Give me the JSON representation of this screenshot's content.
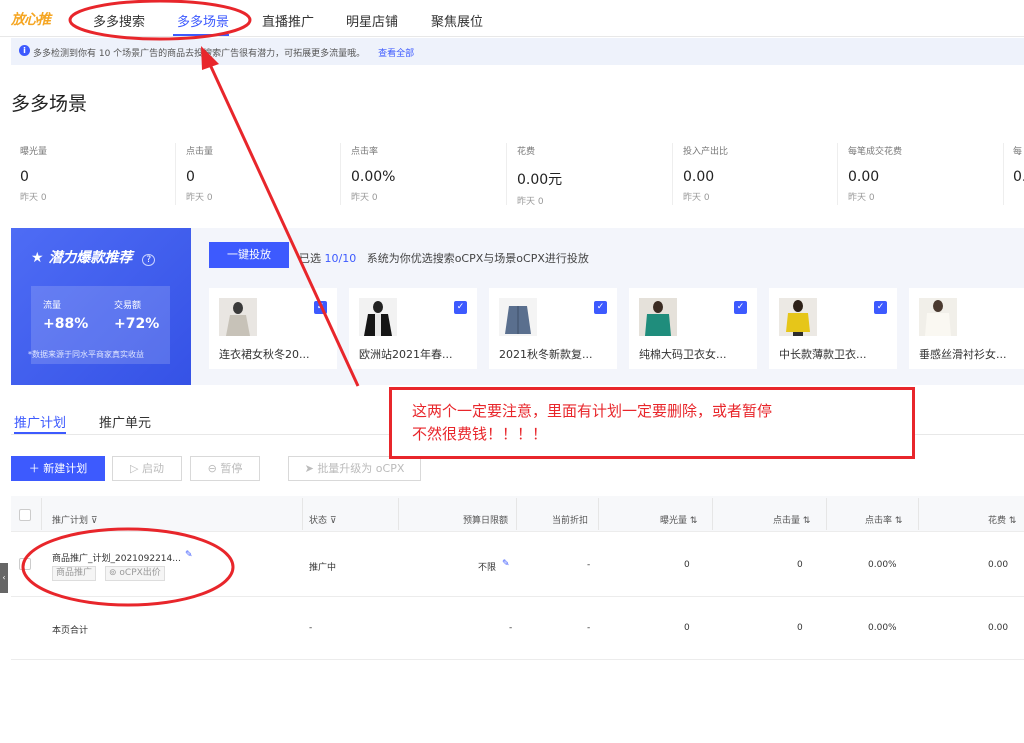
{
  "nav": {
    "logo": "放心推",
    "tabs": [
      {
        "label": "多多搜索"
      },
      {
        "label": "多多场景"
      },
      {
        "label": "直播推广"
      },
      {
        "label": "明星店铺"
      },
      {
        "label": "聚焦展位"
      }
    ],
    "active_index": 1
  },
  "notice": {
    "text": "多多检测到你有 10 个场景广告的商品去投搜索广告很有潜力，可拓展更多流量哦。",
    "link": "查看全部"
  },
  "page_title": "多多场景",
  "metrics": [
    {
      "label": "曝光量",
      "value": "0",
      "sub": "昨天 0"
    },
    {
      "label": "点击量",
      "value": "0",
      "sub": "昨天 0"
    },
    {
      "label": "点击率",
      "value": "0.00%",
      "sub": "昨天 0"
    },
    {
      "label": "花费",
      "value": "0.00元",
      "sub": "昨天 0"
    },
    {
      "label": "投入产出比",
      "value": "0.00",
      "sub": "昨天 0"
    },
    {
      "label": "每笔成交花费",
      "value": "0.00",
      "sub": "昨天 0"
    },
    {
      "label": "每",
      "value": "0.",
      "sub": ""
    }
  ],
  "recommend": {
    "title": "潜力爆款推荐",
    "help": "?",
    "stats": [
      {
        "label": "流量",
        "value": "+88%"
      },
      {
        "label": "交易额",
        "value": "+72%"
      }
    ],
    "note": "*数据来源于同水平商家真实收益",
    "launch_button": "一键投放",
    "selected_prefix": "已选",
    "selected_count": "10/10",
    "selected_desc": "系统为你优选搜索oCPX与场景oCPX进行投放",
    "products": [
      {
        "name": "连衣裙女秋冬20..."
      },
      {
        "name": "欧洲站2021年春..."
      },
      {
        "name": "2021秋冬新款复..."
      },
      {
        "name": "纯棉大码卫衣女..."
      },
      {
        "name": "中长款薄款卫衣..."
      },
      {
        "name": "垂感丝滑衬衫女..."
      }
    ]
  },
  "subtabs": [
    {
      "label": "推广计划"
    },
    {
      "label": "推广单元"
    }
  ],
  "toolbar": {
    "new_plan": "新建计划",
    "start": "启动",
    "pause": "暂停",
    "upgrade": "批量升级为 oCPX"
  },
  "table": {
    "headers": {
      "plan": "推广计划",
      "status": "状态",
      "budget": "预算日限额",
      "discount": "当前折扣",
      "impressions": "曝光量",
      "clicks": "点击量",
      "ctr": "点击率",
      "spend": "花费"
    },
    "rows": [
      {
        "plan": "商品推广_计划_2021092214...",
        "tag1": "商品推广",
        "tag2": "oCPX出价",
        "status": "推广中",
        "budget": "不限",
        "discount": "-",
        "impressions": "0",
        "clicks": "0",
        "ctr": "0.00%",
        "spend": "0.00"
      }
    ],
    "total": {
      "label": "本页合计",
      "status": "-",
      "budget": "-",
      "discount": "-",
      "impressions": "0",
      "clicks": "0",
      "ctr": "0.00%",
      "spend": "0.00"
    }
  },
  "annotation": {
    "line1": "这两个一定要注意，里面有计划一定要删除，或者暂停",
    "line2": "不然很费钱！！！！",
    "color": "#e8262b"
  },
  "colors": {
    "accent": "#3d5afe",
    "annotation": "#e8262b"
  }
}
